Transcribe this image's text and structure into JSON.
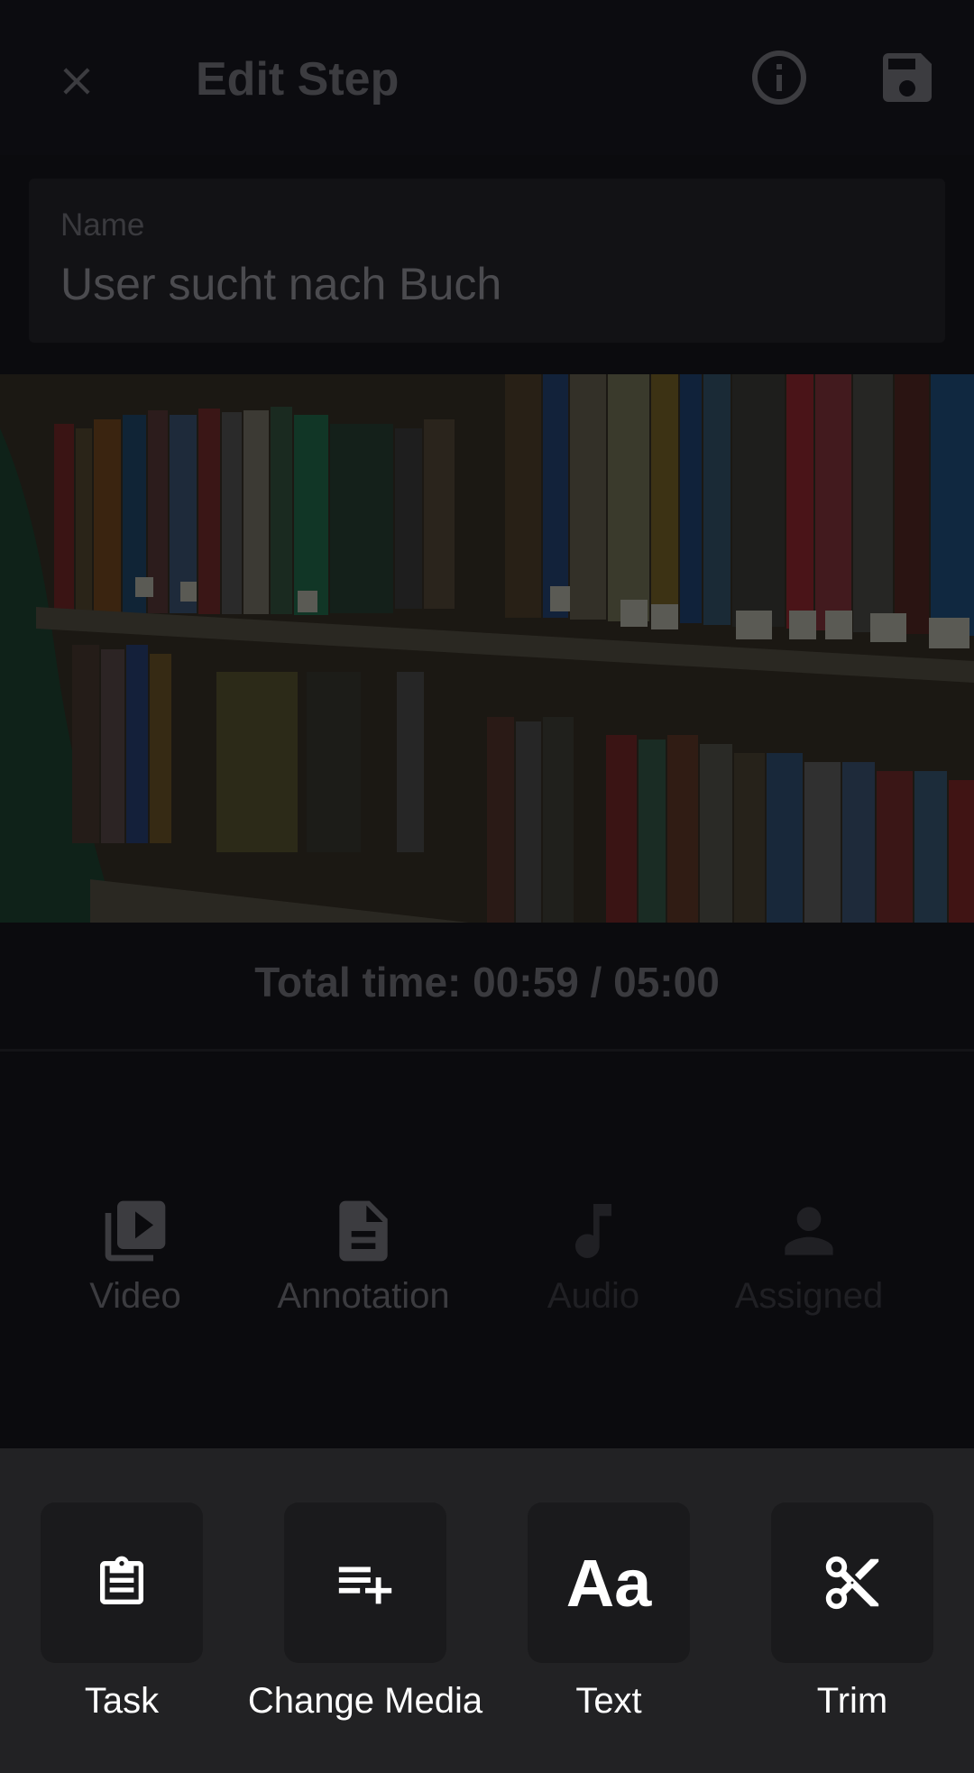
{
  "app_bar": {
    "title": "Edit Step",
    "close_icon": "close-icon",
    "info_icon": "info-icon",
    "save_icon": "save-icon"
  },
  "name_field": {
    "label": "Name",
    "value": "User sucht nach Buch"
  },
  "media": {
    "description_icon": "bookshelf-image"
  },
  "total_time": "Total time: 00:59 / 05:00",
  "tabs": [
    {
      "label": "Video",
      "icon": "video-library-icon",
      "enabled": true
    },
    {
      "label": "Annotation",
      "icon": "document-icon",
      "enabled": true
    },
    {
      "label": "Audio",
      "icon": "music-note-icon",
      "enabled": false
    },
    {
      "label": "Assigned",
      "icon": "person-icon",
      "enabled": false
    }
  ],
  "actions": [
    {
      "label": "Task",
      "icon": "clipboard-icon"
    },
    {
      "label": "Change Media",
      "icon": "playlist-add-icon"
    },
    {
      "label": "Text",
      "icon": "text-icon",
      "glyph": "Aa"
    },
    {
      "label": "Trim",
      "icon": "scissors-icon"
    }
  ]
}
